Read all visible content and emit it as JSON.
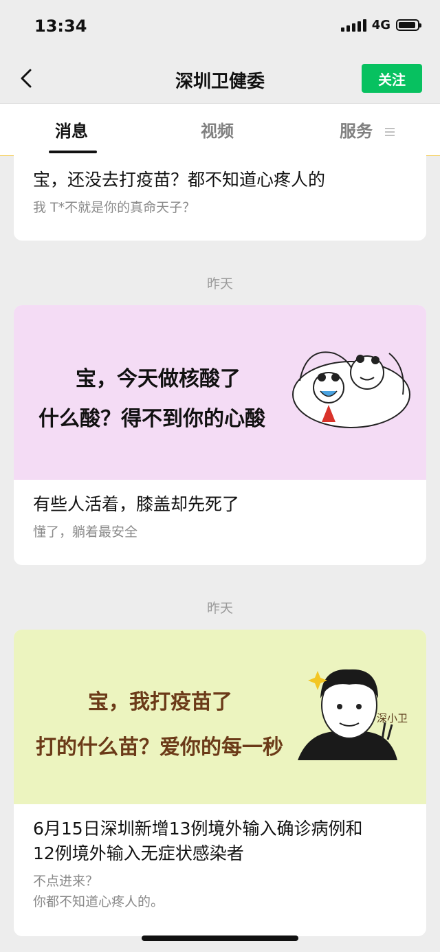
{
  "status": {
    "time": "13:34",
    "network": "4G"
  },
  "nav": {
    "title": "深圳卫健委",
    "follow_label": "关注"
  },
  "tabs": [
    {
      "label": "消息",
      "active": true
    },
    {
      "label": "视频",
      "active": false
    },
    {
      "label": "服务",
      "active": false
    }
  ],
  "messages": [
    {
      "title": "宝，还没去打疫苗？都不知道心疼人的",
      "summary": "我 T*不就是你的真命天子？"
    },
    {
      "date": "昨天",
      "banner": {
        "line1": "宝，今天做核酸了",
        "line2": "什么酸？得不到你的心酸",
        "background": "#f4dcf5"
      },
      "title": "有些人活着，膝盖却先死了",
      "summary": "懂了，躺着最安全"
    },
    {
      "date": "昨天",
      "banner": {
        "line1": "宝，我打疫苗了",
        "line2": "打的什么苗？爱你的每一秒",
        "signature": "深小卫",
        "background": "#ecf4bf"
      },
      "title_line1": "6月15日深圳新增13例境外输入确诊病例和",
      "title_line2": "12例境外输入无症状感染者",
      "summary_line1": "不点进来？",
      "summary_line2": "你都不知道心疼人的。"
    }
  ],
  "colors": {
    "accent": "#07c160",
    "background": "#ededed"
  }
}
